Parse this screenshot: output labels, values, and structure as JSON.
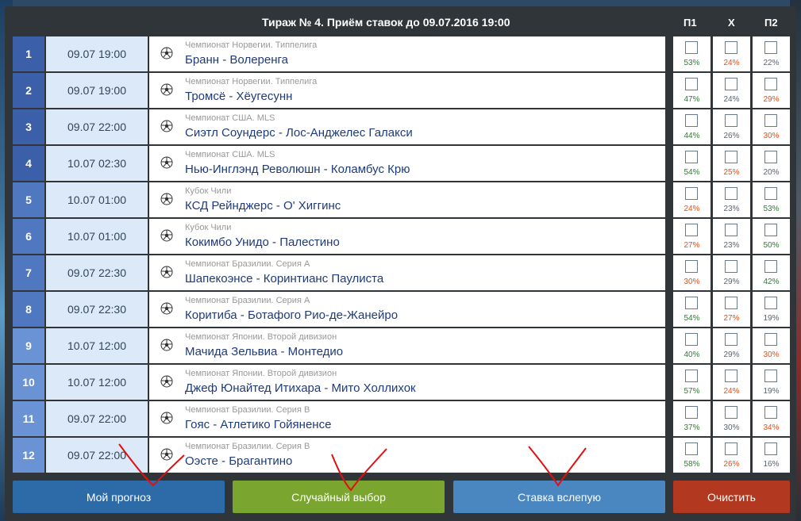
{
  "title": "Тираж № 4. Приём ставок до 09.07.2016 19:00",
  "columns": [
    "П1",
    "Х",
    "П2"
  ],
  "colors": {
    "high": "#2e7d32",
    "low": "#e2501a",
    "mid": "#5a6470"
  },
  "matches": [
    {
      "num": "1",
      "date": "09.07 19:00",
      "league": "Чемпионат Норвегии. Типпелига",
      "teams": "Бранн - Волеренга",
      "p1": "53%",
      "x": "24%",
      "p2": "22%",
      "c": [
        "high",
        "low",
        "mid"
      ]
    },
    {
      "num": "2",
      "date": "09.07 19:00",
      "league": "Чемпионат Норвегии. Типпелига",
      "teams": "Тромсё - Хёугесунн",
      "p1": "47%",
      "x": "24%",
      "p2": "29%",
      "c": [
        "high",
        "mid",
        "low"
      ]
    },
    {
      "num": "3",
      "date": "09.07 22:00",
      "league": "Чемпионат США. MLS",
      "teams": "Сиэтл Соундерс - Лос-Анджелес Галакси",
      "p1": "44%",
      "x": "26%",
      "p2": "30%",
      "c": [
        "high",
        "mid",
        "low"
      ]
    },
    {
      "num": "4",
      "date": "10.07 02:30",
      "league": "Чемпионат США. MLS",
      "teams": "Нью-Инглэнд Революшн - Коламбус Крю",
      "p1": "54%",
      "x": "25%",
      "p2": "20%",
      "c": [
        "high",
        "low",
        "mid"
      ]
    },
    {
      "num": "5",
      "date": "10.07 01:00",
      "league": "Кубок Чили",
      "teams": "КСД Рейнджерс - О' Хиггинс",
      "p1": "24%",
      "x": "23%",
      "p2": "53%",
      "c": [
        "low",
        "mid",
        "high"
      ]
    },
    {
      "num": "6",
      "date": "10.07 01:00",
      "league": "Кубок Чили",
      "teams": "Кокимбо Унидо - Палестино",
      "p1": "27%",
      "x": "23%",
      "p2": "50%",
      "c": [
        "low",
        "mid",
        "high"
      ]
    },
    {
      "num": "7",
      "date": "09.07 22:30",
      "league": "Чемпионат Бразилии. Серия А",
      "teams": "Шапекоэнсе - Коринтианс Паулиста",
      "p1": "30%",
      "x": "29%",
      "p2": "42%",
      "c": [
        "low",
        "mid",
        "high"
      ]
    },
    {
      "num": "8",
      "date": "09.07 22:30",
      "league": "Чемпионат Бразилии. Серия А",
      "teams": "Коритиба - Ботафого Рио-де-Жанейро",
      "p1": "54%",
      "x": "27%",
      "p2": "19%",
      "c": [
        "high",
        "low",
        "mid"
      ]
    },
    {
      "num": "9",
      "date": "10.07 12:00",
      "league": "Чемпионат Японии. Второй дивизион",
      "teams": "Мачида Зельвиа - Монтедио",
      "p1": "40%",
      "x": "29%",
      "p2": "30%",
      "c": [
        "high",
        "mid",
        "low"
      ]
    },
    {
      "num": "10",
      "date": "10.07 12:00",
      "league": "Чемпионат Японии. Второй дивизион",
      "teams": "Джеф Юнайтед Итихара - Мито Холлихок",
      "p1": "57%",
      "x": "24%",
      "p2": "19%",
      "c": [
        "high",
        "low",
        "mid"
      ]
    },
    {
      "num": "11",
      "date": "09.07 22:00",
      "league": "Чемпионат Бразилии. Серия В",
      "teams": "Гояс - Атлетико Гойяненсе",
      "p1": "37%",
      "x": "30%",
      "p2": "34%",
      "c": [
        "high",
        "mid",
        "low"
      ]
    },
    {
      "num": "12",
      "date": "09.07 22:00",
      "league": "Чемпионат Бразилии. Серия В",
      "teams": "Оэсте - Брагантино",
      "p1": "58%",
      "x": "26%",
      "p2": "16%",
      "c": [
        "high",
        "low",
        "mid"
      ]
    }
  ],
  "buttons": {
    "my_forecast": "Мой прогноз",
    "random": "Случайный выбор",
    "blind": "Ставка вслепую",
    "clear": "Очистить"
  }
}
